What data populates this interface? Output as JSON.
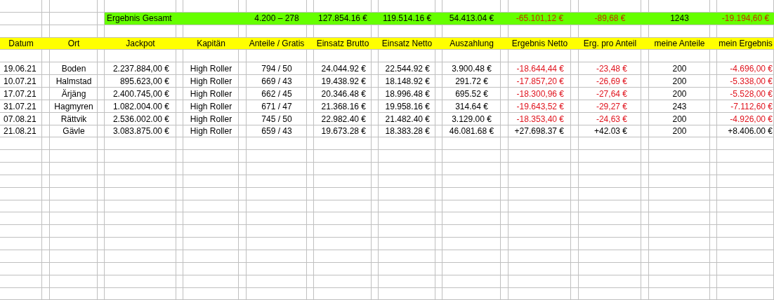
{
  "summary": {
    "label": "Ergebnis Gesamt",
    "anteile_gratis": "4.200 – 278",
    "einsatz_brutto": "127.854.16 €",
    "einsatz_netto": "119.514.16 €",
    "auszahlung": "54.413.04 €",
    "ergebnis_netto": "-65.101,12 €",
    "erg_pro_anteil": "-89,68 €",
    "meine_anteile": "1243",
    "mein_ergebnis": "-19.194,60 €",
    "negative": true
  },
  "columns": [
    "Datum",
    "Ort",
    "Jackpot",
    "Kapitän",
    "Anteile / Gratis",
    "Einsatz Brutto",
    "Einsatz Netto",
    "Auszahlung",
    "Ergebnis Netto",
    "Erg. pro Anteil",
    "meine Anteile",
    "mein Ergebnis"
  ],
  "rows": [
    {
      "datum": "19.06.21",
      "ort": "Boden",
      "jackpot": "2.237.884,00 €",
      "kapitan": "High Roller",
      "anteile_gratis": "794 / 50",
      "einsatz_brutto": "24.044.92 €",
      "einsatz_netto": "22.544.92 €",
      "auszahlung": "3.900.48 €",
      "ergebnis_netto": "-18.644,44 €",
      "erg_pro_anteil": "-23,48 €",
      "meine_anteile": "200",
      "mein_ergebnis": "-4.696,00 €",
      "negative": true
    },
    {
      "datum": "10.07.21",
      "ort": "Halmstad",
      "jackpot": "895.623,00 €",
      "kapitan": "High Roller",
      "anteile_gratis": "669 / 43",
      "einsatz_brutto": "19.438.92 €",
      "einsatz_netto": "18.148.92 €",
      "auszahlung": "291.72 €",
      "ergebnis_netto": "-17.857,20 €",
      "erg_pro_anteil": "-26,69 €",
      "meine_anteile": "200",
      "mein_ergebnis": "-5.338,00 €",
      "negative": true
    },
    {
      "datum": "17.07.21",
      "ort": "Ärjäng",
      "jackpot": "2.400.745,00 €",
      "kapitan": "High Roller",
      "anteile_gratis": "662 / 45",
      "einsatz_brutto": "20.346.48 €",
      "einsatz_netto": "18.996.48 €",
      "auszahlung": "695.52 €",
      "ergebnis_netto": "-18.300,96 €",
      "erg_pro_anteil": "-27,64 €",
      "meine_anteile": "200",
      "mein_ergebnis": "-5.528,00 €",
      "negative": true
    },
    {
      "datum": "31.07.21",
      "ort": "Hagmyren",
      "jackpot": "1.082.004.00 €",
      "kapitan": "High Roller",
      "anteile_gratis": "671 / 47",
      "einsatz_brutto": "21.368.16 €",
      "einsatz_netto": "19.958.16 €",
      "auszahlung": "314.64 €",
      "ergebnis_netto": "-19.643,52 €",
      "erg_pro_anteil": "-29,27 €",
      "meine_anteile": "243",
      "mein_ergebnis": "-7.112,60 €",
      "negative": true
    },
    {
      "datum": "07.08.21",
      "ort": "Rättvik",
      "jackpot": "2.536.002.00 €",
      "kapitan": "High Roller",
      "anteile_gratis": "745 / 50",
      "einsatz_brutto": "22.982.40 €",
      "einsatz_netto": "21.482.40 €",
      "auszahlung": "3.129.00 €",
      "ergebnis_netto": "-18.353,40 €",
      "erg_pro_anteil": "-24,63 €",
      "meine_anteile": "200",
      "mein_ergebnis": "-4.926,00 €",
      "negative": true
    },
    {
      "datum": "21.08.21",
      "ort": "Gävle",
      "jackpot": "3.083.875.00 €",
      "kapitan": "High Roller",
      "anteile_gratis": "659 / 43",
      "einsatz_brutto": "19.673.28 €",
      "einsatz_netto": "18.383.28 €",
      "auszahlung": "46.081.68 €",
      "ergebnis_netto": "+27.698.37 €",
      "erg_pro_anteil": "+42.03 €",
      "meine_anteile": "200",
      "mein_ergebnis": "+8.406.00 €",
      "negative": false
    }
  ]
}
